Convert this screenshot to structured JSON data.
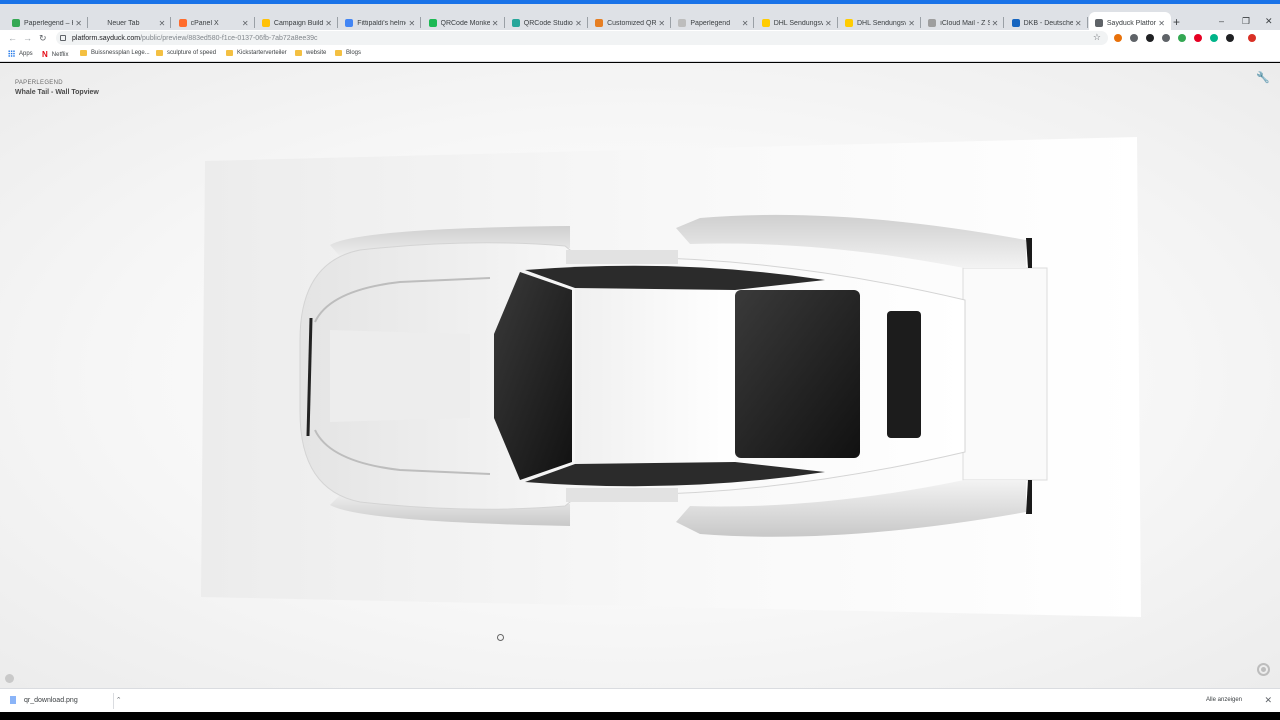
{
  "browser": {
    "tabs": [
      {
        "label": "Paperlegend – Ho",
        "favicon_color": "#34a853",
        "active": false
      },
      {
        "label": "Neuer Tab",
        "favicon_color": "#dee1e6",
        "active": false
      },
      {
        "label": "cPanel X",
        "favicon_color": "#ff6c2c",
        "active": false
      },
      {
        "label": "Campaign Builder",
        "favicon_color": "#ffc107",
        "active": false
      },
      {
        "label": "Fittipaldi's helmet",
        "favicon_color": "#4285f4",
        "active": false
      },
      {
        "label": "QRCode Monkey",
        "favicon_color": "#1db954",
        "active": false
      },
      {
        "label": "QRCode Studio | C",
        "favicon_color": "#26a69a",
        "active": false
      },
      {
        "label": "Customized QR co",
        "favicon_color": "#e67e22",
        "active": false
      },
      {
        "label": "Paperlegend",
        "favicon_color": "#bdbdbd",
        "active": false
      },
      {
        "label": "DHL Sendungsverf",
        "favicon_color": "#ffcc00",
        "active": false
      },
      {
        "label": "DHL Sendungsverf",
        "favicon_color": "#ffcc00",
        "active": false
      },
      {
        "label": "iCloud Mail - Z Su",
        "favicon_color": "#9e9e9e",
        "active": false
      },
      {
        "label": "DKB - Deutsche Kr",
        "favicon_color": "#1565c0",
        "active": false
      },
      {
        "label": "Sayduck Platform",
        "favicon_color": "#5f6368",
        "active": true
      }
    ],
    "new_tab_icon": "+",
    "url": {
      "host": "platform.sayduck.com",
      "path": "/public/preview/883ed580-f1ce-0137-06fb-7ab72a8ee39c"
    },
    "bookmarks": [
      {
        "label": "Apps",
        "icon": "apps-grid-icon"
      },
      {
        "label": "Netflix",
        "icon": "netflix-icon"
      },
      {
        "label": "Buissnessplan Lege...",
        "icon": "folder-icon"
      },
      {
        "label": "sculpture of speed",
        "icon": "folder-icon"
      },
      {
        "label": "Kickstarterverteiler",
        "icon": "folder-icon"
      },
      {
        "label": "website",
        "icon": "folder-icon"
      },
      {
        "label": "Blogs",
        "icon": "folder-icon"
      }
    ],
    "extension_colors": [
      "#e8710a",
      "#5f6368",
      "#202124",
      "#5f6368",
      "#34a853",
      "#e60023",
      "#00b489",
      "#202124",
      "#d93025"
    ]
  },
  "viewer": {
    "brand": "PAPERLEGEND",
    "title": "Whale Tail - Wall Topview"
  },
  "downloads": {
    "file_name": "qr_download.png",
    "show_all": "Alle anzeigen"
  }
}
